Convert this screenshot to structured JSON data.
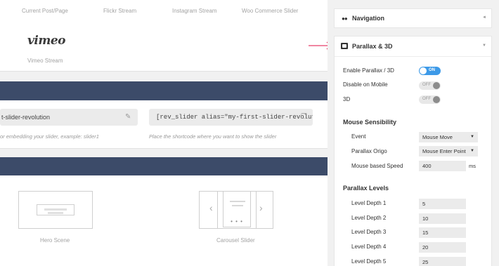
{
  "slider_types": {
    "labels": [
      "Current Post/Page",
      "Flickr Stream",
      "Instagram Stream",
      "Woo Commerce Slider"
    ],
    "vimeo_logo": "vimeo",
    "vimeo_label": "Vimeo Stream"
  },
  "slider_fields": {
    "alias_value": "t-slider-revolution",
    "alias_hint": "or embedding your slider, example: slider1",
    "shortcode_value": "[rev_slider alias=\"my-first-slider-revoluti",
    "shortcode_hint": "Place the shortcode where you want to show the slider",
    "edit_icon": "pencil-icon",
    "copy_icon": "copy-icon"
  },
  "layouts": {
    "hero_label": "Hero Scene",
    "carousel_label": "Carousel Slider",
    "carousel_dots": "• • •"
  },
  "panel": {
    "navigation": {
      "title": "Navigation",
      "chevron": "◄"
    },
    "parallax": {
      "title": "Parallax & 3D",
      "chevron": "▼",
      "enable_label": "Enable Parallax / 3D",
      "enable_state": "ON",
      "mobile_label": "Disable on Mobile",
      "mobile_state": "OFF",
      "threed_label": "3D",
      "threed_state": "OFF",
      "mouse_title": "Mouse Sensibility",
      "event_label": "Event",
      "event_value": "Mouse Move",
      "origo_label": "Parallax Origo",
      "origo_value": "Mouse Enter Point",
      "speed_label": "Mouse based Speed",
      "speed_value": "400",
      "speed_unit": "ms",
      "levels_title": "Parallax Levels",
      "levels": [
        {
          "label": "Level Depth 1",
          "value": "5"
        },
        {
          "label": "Level Depth 2",
          "value": "10"
        },
        {
          "label": "Level Depth 3",
          "value": "15"
        },
        {
          "label": "Level Depth 4",
          "value": "20"
        },
        {
          "label": "Level Depth 5",
          "value": "25"
        }
      ]
    }
  },
  "colors": {
    "header_bar": "#3c4b69",
    "toggle_on": "#3d9ae8",
    "pointer_arrow": "#e63d6a"
  }
}
